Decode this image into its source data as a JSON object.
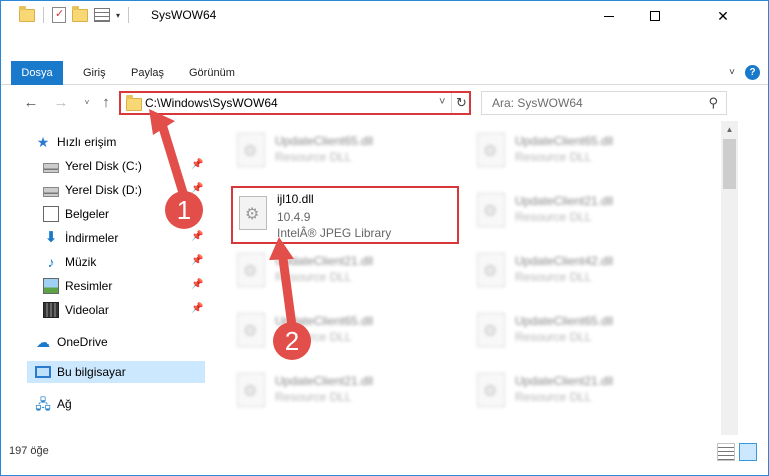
{
  "window": {
    "title": "SysWOW64",
    "controls": {
      "minimize": "—",
      "maximize": "☐",
      "close": "✕"
    }
  },
  "ribbon": {
    "file_tab": "Dosya",
    "tabs": [
      "Giriş",
      "Paylaş",
      "Görünüm"
    ],
    "expand_icon": "˅",
    "help_icon": "?"
  },
  "nav": {
    "back": "←",
    "forward": "→",
    "recent": "˅",
    "up": "↑",
    "address": "C:\\Windows\\SysWOW64",
    "address_dropdown": "˅",
    "refresh": "↻",
    "search_placeholder": "Ara: SysWOW64",
    "search_icon": "⚲"
  },
  "sidebar": {
    "items": [
      {
        "label": "Hızlı erişim",
        "icon": "star-icon",
        "pinned": false
      },
      {
        "label": "Yerel Disk (C:)",
        "icon": "drive-icon",
        "pinned": true
      },
      {
        "label": "Yerel Disk (D:)",
        "icon": "drive-icon",
        "pinned": true
      },
      {
        "label": "Belgeler",
        "icon": "documents-icon",
        "pinned": true
      },
      {
        "label": "İndirmeler",
        "icon": "downloads-icon",
        "pinned": true
      },
      {
        "label": "Müzik",
        "icon": "music-icon",
        "pinned": true
      },
      {
        "label": "Resimler",
        "icon": "pictures-icon",
        "pinned": true
      },
      {
        "label": "Videolar",
        "icon": "videos-icon",
        "pinned": true
      },
      {
        "label": "OneDrive",
        "icon": "onedrive-icon",
        "pinned": false
      },
      {
        "label": "Bu bilgisayar",
        "icon": "this-pc-icon",
        "pinned": false,
        "selected": true
      },
      {
        "label": "Ağ",
        "icon": "network-icon",
        "pinned": false
      }
    ],
    "pin_glyph": "📌"
  },
  "files": {
    "highlighted": {
      "name": "ijl10.dll",
      "version": "10.4.9",
      "description": "IntelÂ® JPEG Library"
    },
    "left_column": [
      {
        "name": "UpdateClient65.dll",
        "desc": "Resource DLL"
      },
      {
        "name": "UpdateClient21.dll",
        "desc": "Resource DLL"
      },
      {
        "name": "UpdateClient65.dll",
        "desc": "Resource DLL"
      },
      {
        "name": "UpdateClient21.dll",
        "desc": "Resource DLL"
      }
    ],
    "right_column": [
      {
        "name": "UpdateClient65.dll",
        "desc": "Resource DLL"
      },
      {
        "name": "UpdateClient21.dll",
        "desc": "Resource DLL"
      },
      {
        "name": "UpdateClient42.dll",
        "desc": "Resource DLL"
      },
      {
        "name": "UpdateClient65.dll",
        "desc": "Resource DLL"
      },
      {
        "name": "UpdateClient21.dll",
        "desc": "Resource DLL"
      }
    ]
  },
  "status": {
    "item_count": "197 öğe"
  },
  "annotations": {
    "callout_1": "1",
    "callout_2": "2",
    "color": "#e24e4a"
  }
}
